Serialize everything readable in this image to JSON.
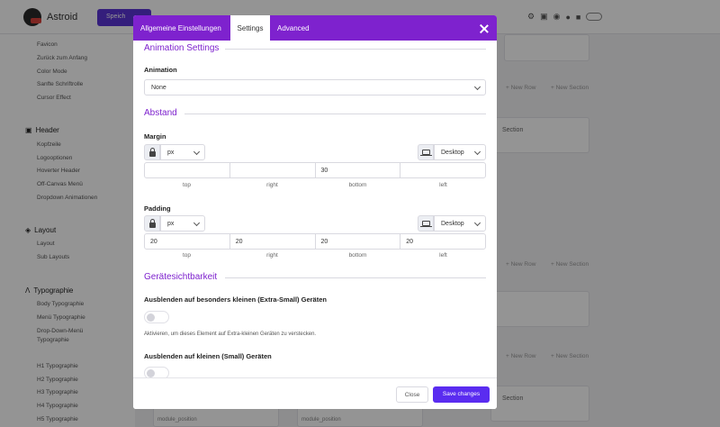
{
  "app": {
    "brand": "Astroid",
    "save_label": "Speich"
  },
  "sidebar": {
    "items_top": [
      "Favicon",
      "Zurück zum Anfang",
      "Color Mode",
      "Sanfte Schriftrolle",
      "Cursor Effect"
    ],
    "header_group": "Header",
    "header_items": [
      "Kopfzeile",
      "Logooptionen",
      "Hoverter Header",
      "Off-Canvas Menü",
      "Dropdown Animationen"
    ],
    "layout_group": "Layout",
    "layout_items": [
      "Layout",
      "Sub Layouts"
    ],
    "typo_group": "Typographie",
    "typo_items": [
      "Body Typographie",
      "Menü Typographie",
      "Drop-Down-Menü Typographie",
      "H1 Typographie",
      "H2 Typographie",
      "H3 Typographie",
      "H4 Typographie",
      "H5 Typographie"
    ]
  },
  "background": {
    "new_row": "+ New Row",
    "new_section": "+ New Section",
    "section_label": "Section",
    "module_position": "module_position"
  },
  "modal": {
    "tabs": [
      "Allgemeine Einstellungen",
      "Settings",
      "Advanced"
    ],
    "active_tab": "Settings",
    "animation_section": "Animation Settings",
    "animation_label": "Animation",
    "animation_value": "None",
    "spacing_section": "Abstand",
    "margin_label": "Margin",
    "margin_unit": "px",
    "margin_device": "Desktop",
    "margin_values": [
      "",
      "",
      "30",
      ""
    ],
    "side_labels": [
      "top",
      "right",
      "bottom",
      "left"
    ],
    "padding_label": "Padding",
    "padding_unit": "px",
    "padding_device": "Desktop",
    "padding_values": [
      "20",
      "20",
      "20",
      "20"
    ],
    "visibility_section": "Gerätesichtbarkeit",
    "hide_xs_label": "Ausblenden auf besonders kleinen (Extra-Small) Geräten",
    "hide_xs_hint": "Aktivieren, um dieses Element auf Extra-kleinen Geräten zu verstecken.",
    "hide_sm_label": "Ausblenden auf kleinen (Small) Geräten",
    "close_label": "Close",
    "save_label": "Save changes"
  },
  "colors": {
    "header": "#7e22ce",
    "primary_button": "#5a2cf0",
    "section_title": "#7e22ce"
  }
}
